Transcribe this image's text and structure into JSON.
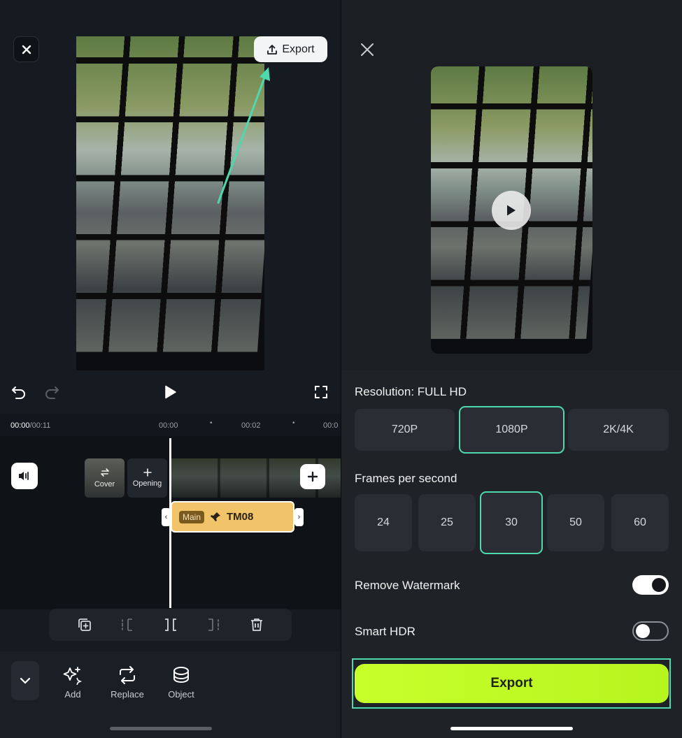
{
  "left": {
    "export_chip_label": "Export",
    "time": {
      "current": "00:00",
      "total": "/00:11",
      "ticks": [
        "00:00",
        "00:02",
        "00:0"
      ]
    },
    "tiles": {
      "cover": "Cover",
      "opening": "Opening"
    },
    "clip": {
      "tag": "Main",
      "title": "TM08"
    },
    "tools": [
      {
        "label": "Add",
        "icon": "sparkle-add-icon"
      },
      {
        "label": "Replace",
        "icon": "replace-icon"
      },
      {
        "label": "Object",
        "icon": "object-icon"
      }
    ]
  },
  "right": {
    "resolution_label": "Resolution: FULL HD",
    "resolutions": [
      "720P",
      "1080P",
      "2K/4K"
    ],
    "selected_resolution": "1080P",
    "fps_label": "Frames per second",
    "fps_options": [
      "24",
      "25",
      "30",
      "50",
      "60"
    ],
    "selected_fps": "30",
    "watermark_label": "Remove Watermark",
    "watermark_on": true,
    "hdr_label": "Smart HDR",
    "hdr_on": false,
    "export_label": "Export"
  },
  "colors": {
    "accent": "#4ed9ad",
    "export_green": "#c7ff2b",
    "clip_yellow": "#f2c46a"
  }
}
